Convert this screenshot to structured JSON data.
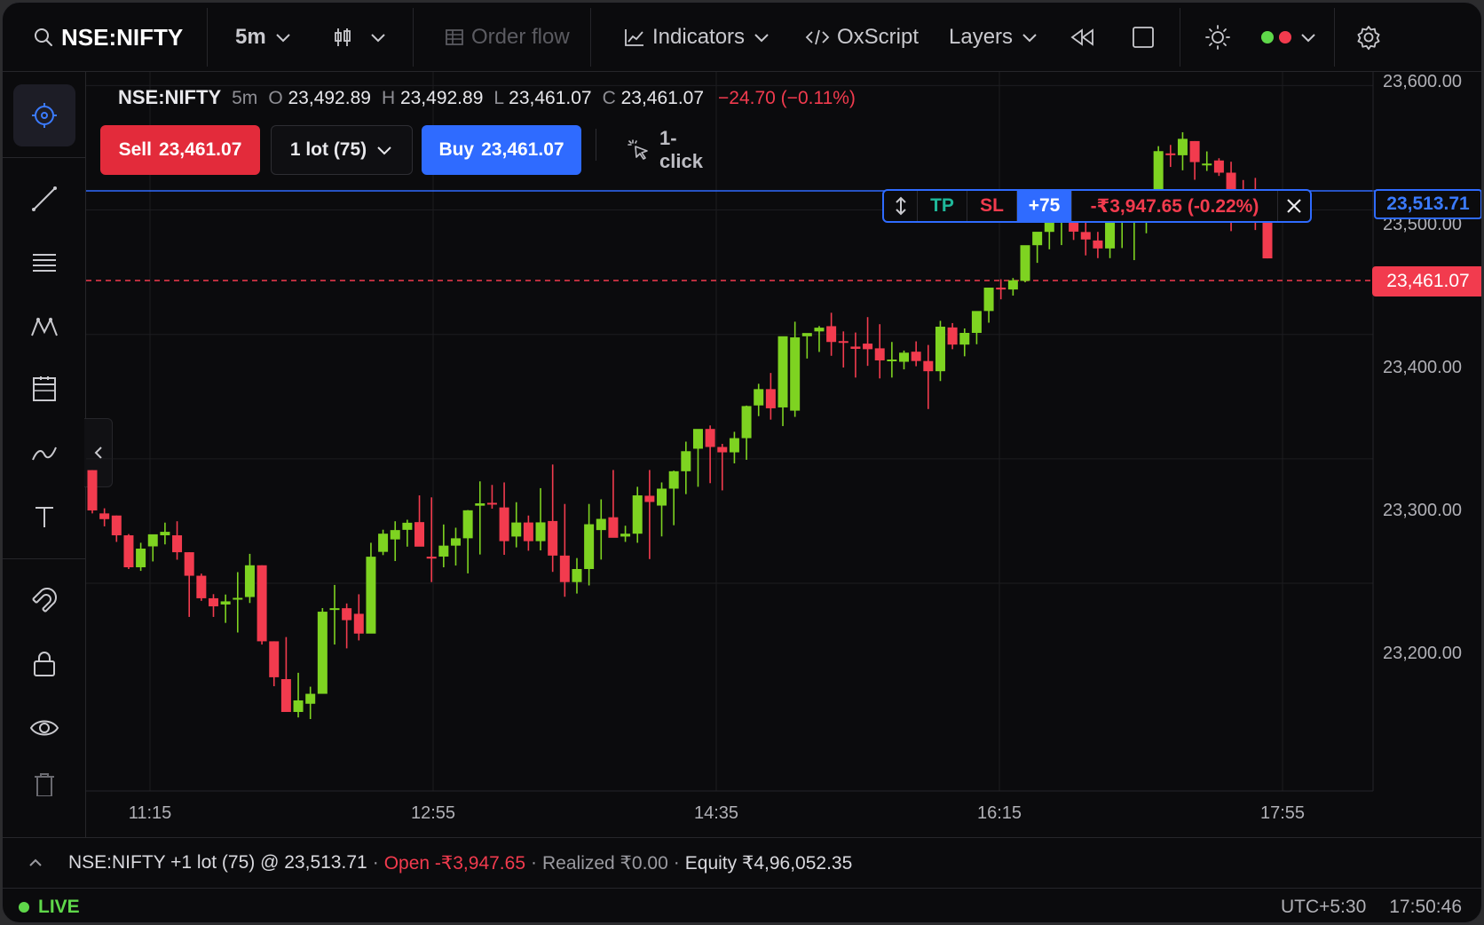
{
  "toolbar": {
    "symbol": "NSE:NIFTY",
    "interval": "5m",
    "order_flow": "Order flow",
    "indicators": "Indicators",
    "oxscript": "OxScript",
    "layers": "Layers"
  },
  "legend": {
    "symbol": "NSE:NIFTY",
    "interval": "5m",
    "o_label": "O",
    "o": "23,492.89",
    "h_label": "H",
    "h": "23,492.89",
    "l_label": "L",
    "l": "23,461.07",
    "c_label": "C",
    "c": "23,461.07",
    "change": "−24.70 (−0.11%)"
  },
  "order": {
    "sell_label": "Sell",
    "sell_price": "23,461.07",
    "lot": "1 lot (75)",
    "buy_label": "Buy",
    "buy_price": "23,461.07",
    "one_click": "1-click"
  },
  "position_widget": {
    "tp": "TP",
    "sl": "SL",
    "qty": "+75",
    "pnl": "-₹3,947.65 (-0.22%)"
  },
  "price_tags": {
    "entry": "23,513.71",
    "last": "23,461.07"
  },
  "bottom": {
    "position": "NSE:NIFTY +1 lot (75) @ 23,513.71",
    "sep": "·",
    "open": "Open -₹3,947.65",
    "realized": "Realized ₹0.00",
    "equity": "Equity ₹4,96,052.35",
    "live": "LIVE",
    "timezone": "UTC+5:30",
    "clock": "17:50:46"
  },
  "colors": {
    "up": "#7ed321",
    "down": "#f23b4e",
    "accent": "#2f6bff",
    "background": "#0b0b0d"
  },
  "icons": [
    "search-icon",
    "chevron-down-icon",
    "candles-icon",
    "grid-icon",
    "chart-line-icon",
    "code-icon",
    "rewind-icon",
    "square-icon",
    "sun-icon",
    "gear-icon",
    "crosshair-icon",
    "trend-line-icon",
    "hlines-icon",
    "pattern-icon",
    "calendar-icon",
    "curve-icon",
    "text-icon",
    "magnet-icon",
    "lock-icon",
    "eye-icon",
    "trash-icon",
    "chevron-left-icon",
    "chevron-up-icon",
    "cursor-click-icon",
    "drag-icon",
    "close-icon"
  ],
  "chart_data": {
    "type": "candlestick",
    "interval": "5m",
    "y_ticks": [
      "23,600.00",
      "23,500.00",
      "23,400.00",
      "23,300.00",
      "23,200.00"
    ],
    "y_tick_values": [
      23600,
      23500,
      23400,
      23300,
      23200
    ],
    "x_ticks": [
      "11:15",
      "12:55",
      "14:35",
      "16:15",
      "17:55"
    ],
    "ylim": [
      23033,
      23611
    ],
    "entry_price": 23513.71,
    "last_price": 23461.07,
    "candles": [
      [
        23290.9,
        23290.9,
        23256.1,
        23258.5
      ],
      [
        23256.1,
        23260.2,
        23245.7,
        23251.5
      ],
      [
        23254.4,
        23254.4,
        23233.2,
        23238.5
      ],
      [
        23238.5,
        23239.5,
        23211.4,
        23212.8
      ],
      [
        23212.8,
        23232.5,
        23209.9,
        23227.8
      ],
      [
        23229.6,
        23238.5,
        23217.5,
        23239.3
      ],
      [
        23238.5,
        23248.7,
        23231.2,
        23241.3
      ],
      [
        23238.5,
        23249.8,
        23218.9,
        23224.9
      ],
      [
        23224.9,
        23224.9,
        23172.9,
        23206.0
      ],
      [
        23206.0,
        23207.7,
        23185.8,
        23187.9
      ],
      [
        23187.9,
        23191.2,
        23172.9,
        23181.4
      ],
      [
        23182.9,
        23190.9,
        23168.1,
        23185.4
      ],
      [
        23187.9,
        23208.9,
        23160.4,
        23188.2
      ],
      [
        23188.9,
        23223.6,
        23184.1,
        23214.4
      ],
      [
        23214.4,
        23214.4,
        23150.7,
        23153.3
      ],
      [
        23153.3,
        23153.3,
        23117.2,
        23124.4
      ],
      [
        23122.9,
        23156.7,
        23106.0,
        23096.5
      ],
      [
        23096.5,
        23128.0,
        23092.1,
        23105.8
      ],
      [
        23103.1,
        23116.8,
        23090.8,
        23111.1
      ],
      [
        23111.1,
        23180.0,
        23122.2,
        23177.1
      ],
      [
        23178.6,
        23198.6,
        23150.7,
        23179.9
      ],
      [
        23179.9,
        23183.7,
        23147.6,
        23170.3
      ],
      [
        23175.4,
        23191.1,
        23154.0,
        23159.5
      ],
      [
        23159.5,
        23232.5,
        23170.0,
        23221.3
      ],
      [
        23225.2,
        23243.0,
        23222.6,
        23239.8
      ],
      [
        23235.2,
        23249.8,
        23217.8,
        23242.7
      ],
      [
        23242.9,
        23251.0,
        23229.4,
        23248.6
      ],
      [
        23249.1,
        23270.6,
        23230.3,
        23229.4
      ],
      [
        23221.3,
        23269.0,
        23200.9,
        23219.8
      ],
      [
        23221.4,
        23247.2,
        23212.8,
        23230.2
      ],
      [
        23230.2,
        23244.6,
        23214.2,
        23236.1
      ],
      [
        23236.1,
        23258.8,
        23207.9,
        23258.6
      ],
      [
        23262.3,
        23281.9,
        23223.1,
        23264.2
      ],
      [
        23264.6,
        23279.0,
        23259.9,
        23263.7
      ],
      [
        23260.9,
        23281.0,
        23222.8,
        23233.8
      ],
      [
        23237.5,
        23265.1,
        23228.8,
        23248.8
      ],
      [
        23248.8,
        23254.4,
        23226.1,
        23233.8
      ],
      [
        23233.8,
        23276.4,
        23226.4,
        23248.9
      ],
      [
        23250.0,
        23295.4,
        23209.1,
        23222.2
      ],
      [
        23222.2,
        23263.7,
        23189.1,
        23200.9
      ],
      [
        23200.9,
        23220.2,
        23191.7,
        23211.4
      ],
      [
        23211.4,
        23263.7,
        23198.2,
        23247.4
      ],
      [
        23242.7,
        23267.4,
        23219.0,
        23251.7
      ],
      [
        23253.0,
        23291.0,
        23240.9,
        23236.5
      ],
      [
        23237.5,
        23246.2,
        23233.2,
        23239.8
      ],
      [
        23239.8,
        23277.5,
        23232.5,
        23270.6
      ],
      [
        23270.3,
        23291.0,
        23219.4,
        23265.3
      ],
      [
        23262.4,
        23281.0,
        23237.6,
        23276.0
      ],
      [
        23276.0,
        23290.5,
        23246.6,
        23290.0
      ],
      [
        23290.0,
        23313.8,
        23271.6,
        23306.1
      ],
      [
        23308.1,
        23320.5,
        23277.5,
        23324.0
      ],
      [
        23324.0,
        23326.8,
        23280.4,
        23309.5
      ],
      [
        23309.5,
        23312.0,
        23274.6,
        23305.2
      ],
      [
        23305.2,
        23321.7,
        23296.3,
        23316.6
      ],
      [
        23316.6,
        23342.8,
        23299.2,
        23342.4
      ],
      [
        23342.9,
        23360.3,
        23334.3,
        23356.0
      ],
      [
        23356.0,
        23369.0,
        23331.5,
        23340.6
      ],
      [
        23341.3,
        23384.2,
        23326.3,
        23398.5
      ],
      [
        23338.7,
        23410.2,
        23333.7,
        23397.6
      ],
      [
        23398.5,
        23398.5,
        23380.6,
        23401.1
      ],
      [
        23402.4,
        23406.7,
        23385.9,
        23405.4
      ],
      [
        23406.6,
        23417.4,
        23382.8,
        23393.9
      ],
      [
        23394.6,
        23402.4,
        23373.4,
        23393.9
      ],
      [
        23390.2,
        23401.5,
        23365.3,
        23388.4
      ],
      [
        23392.6,
        23413.9,
        23374.7,
        23388.1
      ],
      [
        23388.8,
        23408.2,
        23364.6,
        23379.1
      ],
      [
        23379.1,
        23393.9,
        23365.3,
        23379.8
      ],
      [
        23378.0,
        23387.0,
        23371.9,
        23385.3
      ],
      [
        23386.1,
        23394.4,
        23374.4,
        23378.6
      ],
      [
        23378.6,
        23391.5,
        23340.0,
        23370.4
      ],
      [
        23370.4,
        23410.9,
        23362.5,
        23406.2
      ],
      [
        23405.6,
        23409.1,
        23388.1,
        23391.8
      ],
      [
        23391.8,
        23404.8,
        23382.4,
        23401.2
      ],
      [
        23401.2,
        23414.0,
        23392.1,
        23418.8
      ],
      [
        23418.8,
        23426.9,
        23409.4,
        23437.6
      ],
      [
        23437.6,
        23444.3,
        23428.2,
        23436.1
      ],
      [
        23436.1,
        23445.3,
        23431.2,
        23443.5
      ],
      [
        23443.0,
        23467.4,
        23441.9,
        23471.7
      ],
      [
        23471.7,
        23481.3,
        23457.5,
        23482.5
      ],
      [
        23482.4,
        23504.2,
        23468.4,
        23493.0
      ],
      [
        23492.9,
        23502.2,
        23471.8,
        23494.5
      ],
      [
        23493.3,
        23502.9,
        23475.9,
        23482.6
      ],
      [
        23482.3,
        23493.7,
        23463.5,
        23476.3
      ],
      [
        23475.5,
        23482.4,
        23461.3,
        23469.1
      ],
      [
        23469.1,
        23486.7,
        23461.3,
        23490.4
      ],
      [
        23491.9,
        23498.8,
        23469.4,
        23496.7
      ],
      [
        23492.0,
        23494.5,
        23459.7,
        23501.8
      ],
      [
        23505.2,
        23500.5,
        23481.3,
        23513.1
      ],
      [
        23505.7,
        23551.3,
        23512.5,
        23547.3
      ],
      [
        23545.5,
        23552.3,
        23534.6,
        23544.5
      ],
      [
        23544.0,
        23562.5,
        23531.9,
        23557.2
      ],
      [
        23555.4,
        23555.4,
        23524.3,
        23538.5
      ],
      [
        23536.1,
        23547.1,
        23531.4,
        23537.3
      ],
      [
        23539.8,
        23541.6,
        23527.4,
        23530.0
      ],
      [
        23530.0,
        23538.8,
        23483.0,
        23508.0
      ],
      [
        23505.1,
        23524.1,
        23494.1,
        23503.0
      ],
      [
        23503.2,
        23525.8,
        23483.9,
        23496.5
      ],
      [
        23492.9,
        23492.9,
        23461.1,
        23461.1
      ]
    ]
  }
}
